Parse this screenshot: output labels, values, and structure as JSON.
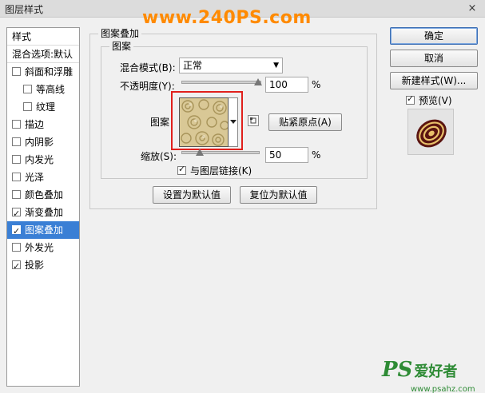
{
  "window": {
    "title": "图层样式",
    "close": "×"
  },
  "watermark": "www.240PS.com",
  "left": {
    "header": "样式",
    "blend_options": "混合选项:默认",
    "items": [
      {
        "label": "斜面和浮雕",
        "checked": false,
        "sub": false,
        "selected": false
      },
      {
        "label": "等高线",
        "checked": false,
        "sub": true,
        "selected": false
      },
      {
        "label": "纹理",
        "checked": false,
        "sub": true,
        "selected": false
      },
      {
        "label": "描边",
        "checked": false,
        "sub": false,
        "selected": false
      },
      {
        "label": "内阴影",
        "checked": false,
        "sub": false,
        "selected": false
      },
      {
        "label": "内发光",
        "checked": false,
        "sub": false,
        "selected": false
      },
      {
        "label": "光泽",
        "checked": false,
        "sub": false,
        "selected": false
      },
      {
        "label": "颜色叠加",
        "checked": false,
        "sub": false,
        "selected": false
      },
      {
        "label": "渐变叠加",
        "checked": true,
        "sub": false,
        "selected": false
      },
      {
        "label": "图案叠加",
        "checked": true,
        "sub": false,
        "selected": true
      },
      {
        "label": "外发光",
        "checked": false,
        "sub": false,
        "selected": false
      },
      {
        "label": "投影",
        "checked": true,
        "sub": false,
        "selected": false
      }
    ]
  },
  "overlay": {
    "group_title": "图案叠加",
    "sub_title": "图案",
    "blend_mode_label": "混合模式(B):",
    "blend_mode_value": "正常",
    "opacity_label": "不透明度(Y):",
    "opacity_value": "100",
    "opacity_unit": "%",
    "pattern_label": "图案",
    "snap_button": "贴紧原点(A)",
    "scale_label": "缩放(S):",
    "scale_value": "50",
    "scale_unit": "%",
    "link_label": "与图层链接(K)",
    "link_checked": true,
    "set_default": "设置为默认值",
    "reset_default": "复位为默认值"
  },
  "right": {
    "ok": "确定",
    "cancel": "取消",
    "new_style": "新建样式(W)...",
    "preview_label": "预览(V)",
    "preview_checked": true
  },
  "footer": {
    "ps": "PS",
    "cn": "爱好者",
    "url": "www.psahz.com"
  },
  "colors": {
    "selection": "#3a7fd5",
    "highlight_border": "#e0201c",
    "watermark": "#ff8a00",
    "footer": "#2e8b35"
  }
}
